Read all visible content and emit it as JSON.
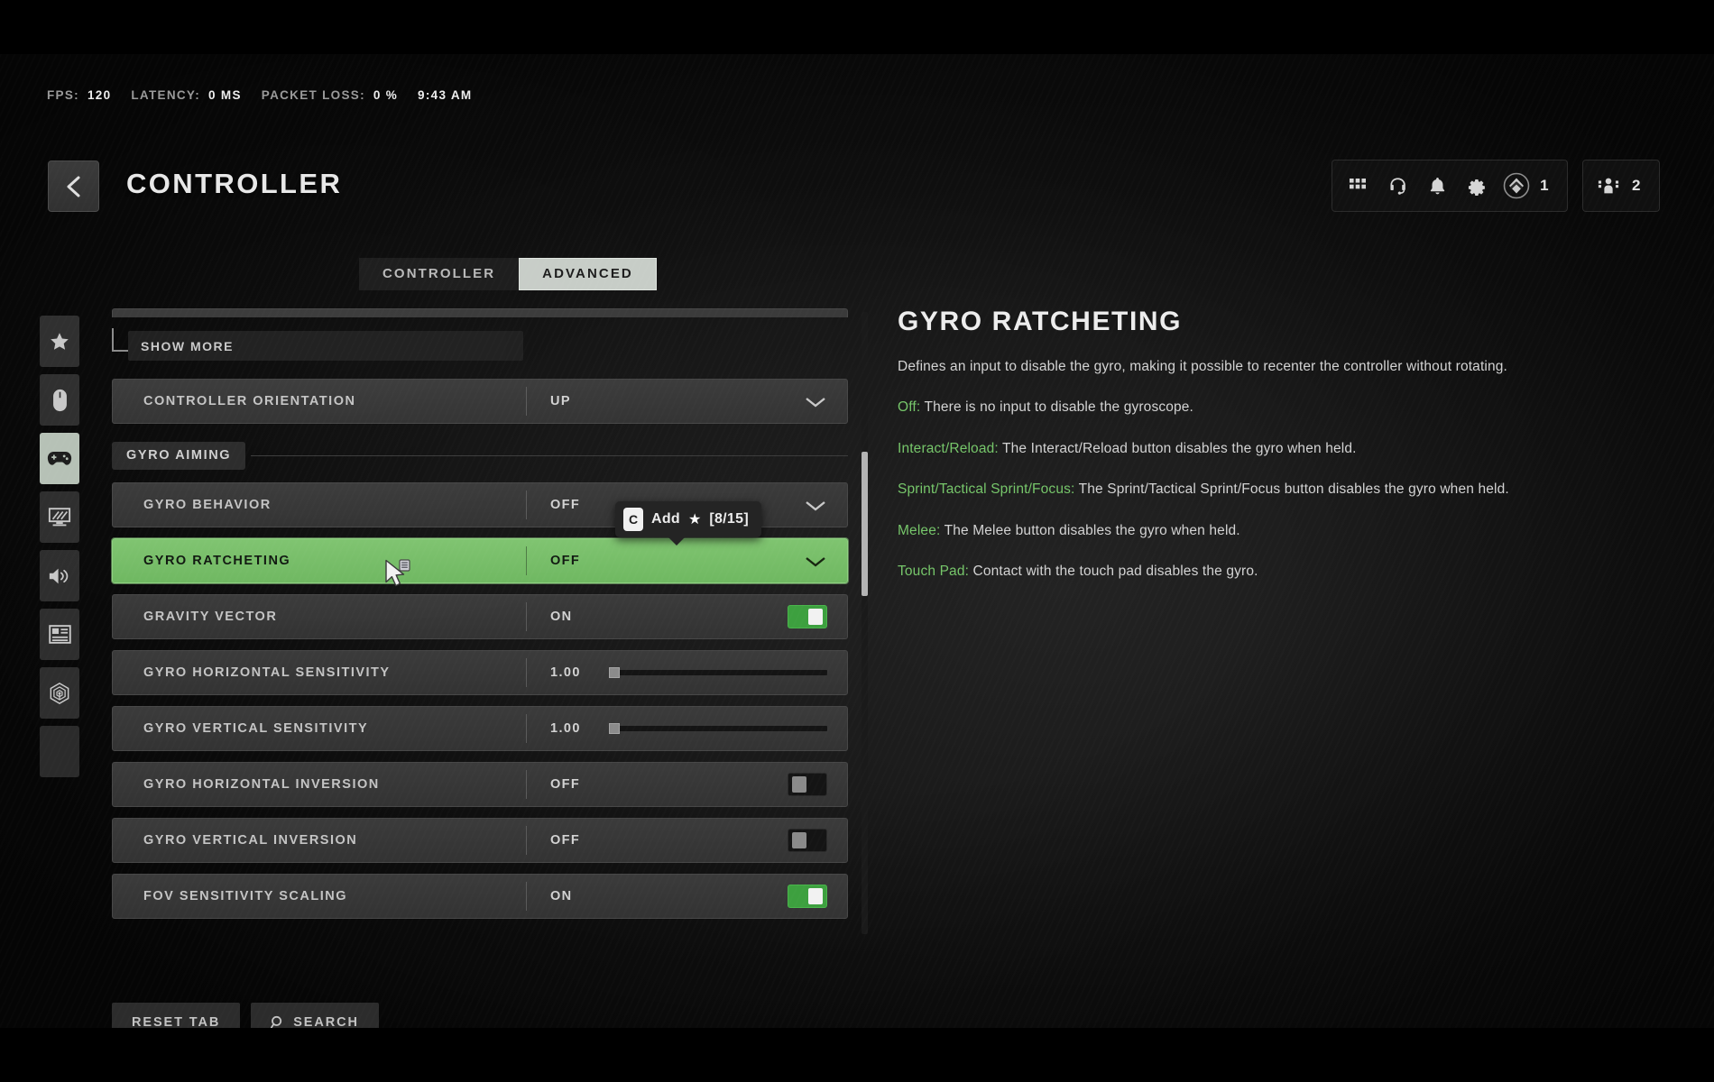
{
  "status_bar": {
    "fps_label": "FPS:",
    "fps_value": "120",
    "latency_label": "LATENCY:",
    "latency_value": "0 MS",
    "packet_loss_label": "PACKET LOSS:",
    "packet_loss_value": "0 %",
    "time": "9:43 AM"
  },
  "header": {
    "back_icon": "chevron-left-icon",
    "title": "CONTROLLER"
  },
  "top_right": {
    "icons": [
      {
        "name": "grid-icon"
      },
      {
        "name": "headset-icon"
      },
      {
        "name": "bell-icon"
      },
      {
        "name": "gear-icon"
      }
    ],
    "rank_icon": "rank-diamond-icon",
    "rank_count": "1",
    "party_icon": "party-members-icon",
    "party_count": "2"
  },
  "tabs": [
    {
      "label": "CONTROLLER",
      "active": false
    },
    {
      "label": "ADVANCED",
      "active": true
    }
  ],
  "sidebar": {
    "items": [
      {
        "icon": "star-icon",
        "name": "sidebar-item-favorites",
        "active": false
      },
      {
        "icon": "mouse-icon",
        "name": "sidebar-item-mouse-keyboard",
        "active": false
      },
      {
        "icon": "gamepad-icon",
        "name": "sidebar-item-controller",
        "active": true
      },
      {
        "icon": "monitor-graphics-icon",
        "name": "sidebar-item-graphics",
        "active": false
      },
      {
        "icon": "speaker-icon",
        "name": "sidebar-item-audio",
        "active": false
      },
      {
        "icon": "interface-panel-icon",
        "name": "sidebar-item-interface",
        "active": false
      },
      {
        "icon": "accessibility-radar-icon",
        "name": "sidebar-item-accessibility",
        "active": false
      },
      {
        "icon": "blank-icon",
        "name": "sidebar-item-blank",
        "active": false
      }
    ]
  },
  "settings": {
    "show_more_label": "SHOW MORE",
    "controller_orientation": {
      "label": "CONTROLLER ORIENTATION",
      "value": "UP",
      "control": "dropdown"
    },
    "section_header": "GYRO AIMING",
    "rows": [
      {
        "label": "GYRO BEHAVIOR",
        "value": "OFF",
        "control": "dropdown",
        "selected": false
      },
      {
        "label": "GYRO RATCHETING",
        "value": "OFF",
        "control": "dropdown",
        "selected": true
      },
      {
        "label": "GRAVITY VECTOR",
        "value": "ON",
        "control": "toggle-on",
        "selected": false
      },
      {
        "label": "GYRO HORIZONTAL SENSITIVITY",
        "value": "1.00",
        "control": "slider",
        "slider_pct": 0,
        "selected": false
      },
      {
        "label": "GYRO VERTICAL SENSITIVITY",
        "value": "1.00",
        "control": "slider",
        "slider_pct": 0,
        "selected": false
      },
      {
        "label": "GYRO HORIZONTAL INVERSION",
        "value": "OFF",
        "control": "toggle-off",
        "selected": false
      },
      {
        "label": "GYRO VERTICAL INVERSION",
        "value": "OFF",
        "control": "toggle-off",
        "selected": false
      },
      {
        "label": "FOV SENSITIVITY SCALING",
        "value": "ON",
        "control": "toggle-on",
        "selected": false
      }
    ]
  },
  "tooltip": {
    "keycap": "C",
    "action": "Add",
    "star": "★",
    "count": "[8/15]"
  },
  "detail": {
    "title": "GYRO RATCHETING",
    "intro": "Defines an input to disable the gyro, making it possible to recenter the controller without rotating.",
    "options": [
      {
        "key": "Off:",
        "text": " There is no input to disable the gyroscope."
      },
      {
        "key": "Interact/Reload:",
        "text": " The Interact/Reload button disables the gyro when held."
      },
      {
        "key": "Sprint/Tactical Sprint/Focus:",
        "text": " The Sprint/Tactical Sprint/Focus button disables the gyro when held."
      },
      {
        "key": "Melee:",
        "text": " The Melee button disables the gyro when held."
      },
      {
        "key": "Touch Pad:",
        "text": " Contact with the touch pad disables the gyro."
      }
    ]
  },
  "bottom_buttons": [
    {
      "label": "RESET TAB",
      "icon": null,
      "name": "reset-tab-button"
    },
    {
      "label": "SEARCH",
      "icon": "search-icon",
      "name": "search-button"
    }
  ],
  "colors": {
    "accent_green": "#6fb861",
    "key_green": "#76c66a",
    "toggle_on": "#3da03f"
  }
}
